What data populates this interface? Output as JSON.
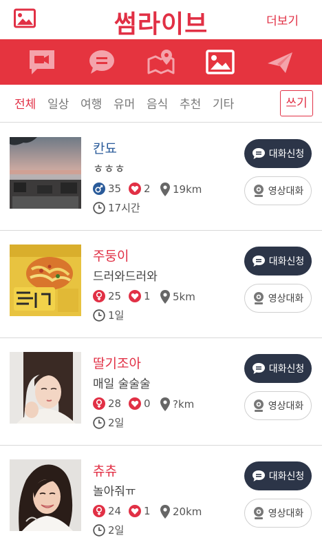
{
  "header": {
    "title": "썸라이브",
    "more_label": "더보기",
    "gallery_icon": "image-icon"
  },
  "iconbar": {
    "items": [
      {
        "icon": "video-chat-icon"
      },
      {
        "icon": "chat-bubble-icon"
      },
      {
        "icon": "map-icon"
      },
      {
        "icon": "gallery-icon",
        "active": true
      },
      {
        "icon": "send-icon"
      }
    ]
  },
  "tabs": {
    "items": [
      "전체",
      "일상",
      "여행",
      "유머",
      "음식",
      "추천",
      "기타"
    ],
    "active": "전체",
    "write_label": "쓰기"
  },
  "colors": {
    "accent": "#e13045",
    "bar": "#e5343f",
    "male": "#2a5b9a",
    "dark_button": "#2c3548"
  },
  "posts": [
    {
      "name": "칸됴",
      "gender": "male",
      "status": "ㅎㅎㅎ",
      "age": "35",
      "likes": "2",
      "distance": "19km",
      "time": "17시간",
      "chat_label": "대화신청",
      "video_label": "영상대화"
    },
    {
      "name": "주둥이",
      "gender": "female",
      "status": "드러와드러와",
      "age": "25",
      "likes": "1",
      "distance": "5km",
      "time": "1일",
      "chat_label": "대화신청",
      "video_label": "영상대화"
    },
    {
      "name": "딸기조아",
      "gender": "female",
      "status": "매일 술술술",
      "age": "28",
      "likes": "0",
      "distance": "?km",
      "time": "2일",
      "chat_label": "대화신청",
      "video_label": "영상대화"
    },
    {
      "name": "츄츄",
      "gender": "female",
      "status": "놀아줘ㅠ",
      "age": "24",
      "likes": "1",
      "distance": "20km",
      "time": "2일",
      "chat_label": "대화신청",
      "video_label": "영상대화"
    }
  ]
}
